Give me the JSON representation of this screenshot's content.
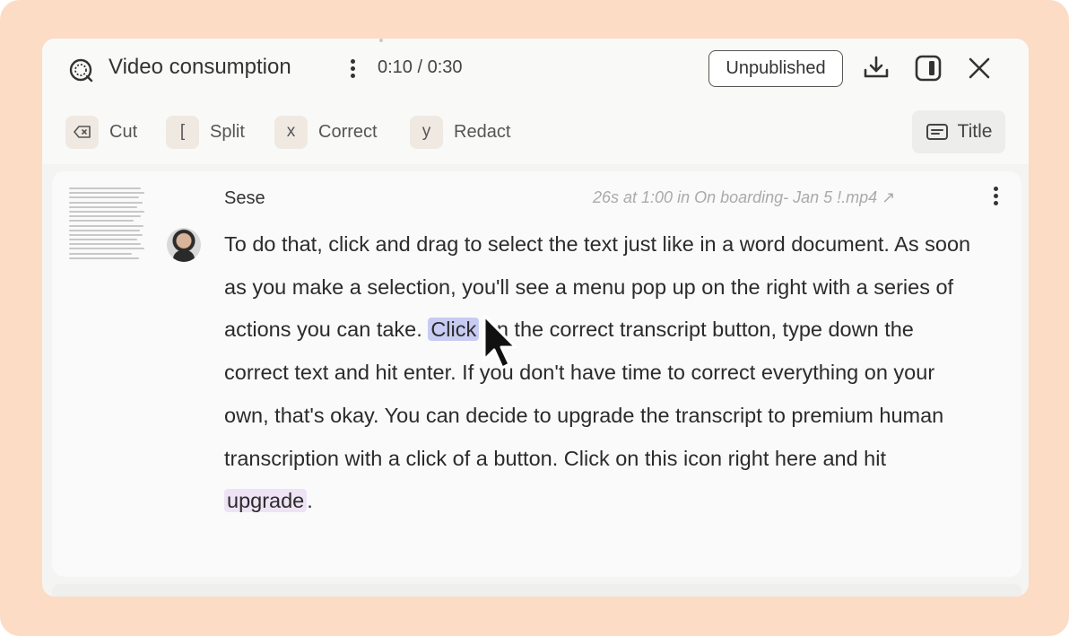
{
  "header": {
    "title": "Video consumption",
    "timer": "0:10 / 0:30",
    "status_badge": "Unpublished",
    "icons": [
      "app-logo-icon",
      "more-vertical-icon",
      "download-icon",
      "side-panel-icon",
      "close-icon"
    ]
  },
  "toolbar": {
    "items": [
      {
        "key": "⌫",
        "label": "Cut"
      },
      {
        "key": "[",
        "label": "Split"
      },
      {
        "key": "x",
        "label": "Correct"
      },
      {
        "key": "y",
        "label": "Redact"
      }
    ],
    "title_button": "Title"
  },
  "transcript_card": {
    "speaker": "Sese",
    "meta": "26s at 1:00 in On boarding- Jan 5 !.mp4 ↗",
    "text_parts": [
      "To do that, click and drag to select the text just like in a word document. As soon as you make a selection, you'll see a menu pop up on the right with a series of actions you can take. ",
      "Click",
      " on the correct transcript button, type down the correct text and hit enter. If you don't have time to correct everything on your own, that's okay. You can decide to upgrade the transcript to premium human transcription with a click of a button. Click on this icon right here and hit ",
      "upgrade",
      "."
    ]
  },
  "colors": {
    "frame_bg": "#fcdcc4",
    "selection_highlight": "#c8ccf2",
    "word_highlight": "#eee3f5"
  }
}
